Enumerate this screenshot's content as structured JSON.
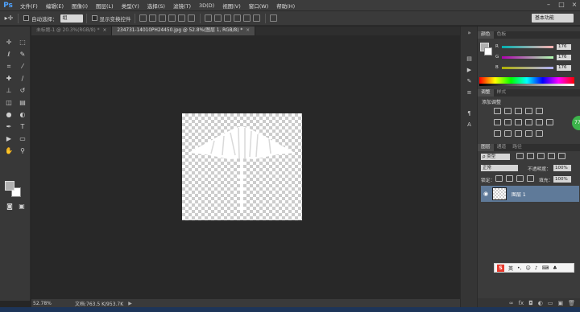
{
  "app": {
    "logo": "Ps"
  },
  "menu": [
    "文件(F)",
    "编辑(E)",
    "图像(I)",
    "图层(L)",
    "类型(Y)",
    "选择(S)",
    "滤镜(T)",
    "3D(D)",
    "视图(V)",
    "窗口(W)",
    "帮助(H)"
  ],
  "options": {
    "auto_select_label": "自动选择：",
    "auto_select_value": "组",
    "show_transform_label": "显示变换控件",
    "workspace": "基本功能"
  },
  "tabs": [
    {
      "label": "未标题-1 @ 20.3%(RGB/8) *",
      "close": "×"
    },
    {
      "label": "234731-14010PH24450.jpg @ 52.8%(图层 1, RGB/8) *",
      "close": "×"
    }
  ],
  "status": {
    "zoom": "52.78%",
    "doc_info": "文档:763.5 K/953.7K"
  },
  "color_panel": {
    "tabs": [
      "颜色",
      "色板"
    ],
    "sliders": [
      {
        "label": "R",
        "value": "176",
        "gradient": "linear-gradient(to right, #00b0b0, #ffb0b0)"
      },
      {
        "label": "G",
        "value": "176",
        "gradient": "linear-gradient(to right, #b000b0, #b0ffb0)"
      },
      {
        "label": "B",
        "value": "176",
        "gradient": "linear-gradient(to right, #b0b000, #b0b0ff)"
      }
    ]
  },
  "adjustments_panel": {
    "tabs": [
      "调整",
      "样式"
    ],
    "title": "添加调整"
  },
  "layers_panel": {
    "tabs": [
      "图层",
      "通道",
      "路径"
    ],
    "filter": "ρ 类型",
    "blend_mode": "正常",
    "opacity_label": "不透明度：",
    "opacity_value": "100%",
    "lock_label": "锁定：",
    "fill_label": "填充：",
    "fill_value": "100%",
    "layers": [
      {
        "name": "图层 1"
      }
    ]
  },
  "ime": {
    "label": "英"
  },
  "float_badge": "77",
  "colors": {
    "accent": "#4fa3ff",
    "selected_layer": "#5f7a99",
    "foreground": "#b0b0b0",
    "background": "#ffffff"
  }
}
